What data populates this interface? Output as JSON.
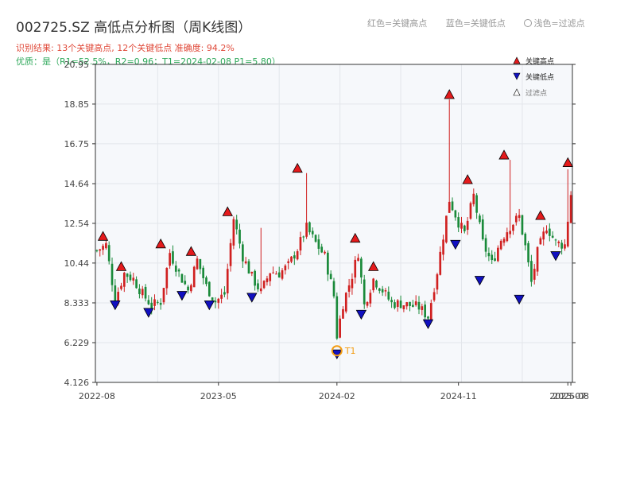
{
  "header": {
    "title": "002725.SZ 高低点分析图（周K线图）",
    "subtitle_result": "识别结果: 13个关键高点, 12个关键低点   准确度: 94.2%",
    "subtitle_quality": "优质：是（R1=52.5%，R2=0.96；T1=2024-02-08 P1=5.80）",
    "color_key": [
      {
        "text": "红色=关键高点"
      },
      {
        "text": "蓝色=关键低点"
      },
      {
        "text": "浅色=过滤点"
      }
    ]
  },
  "legend": {
    "entries": [
      {
        "label": "关键高点",
        "color": "#e41a1c"
      },
      {
        "label": "关键低点",
        "color": "#1010c0"
      },
      {
        "label": "过滤点",
        "color": "#ffffff"
      }
    ]
  },
  "chart_data": {
    "type": "candlestick",
    "yticks": [
      "4.126",
      "6.229",
      "8.333",
      "10.44",
      "12.54",
      "14.64",
      "16.75",
      "18.85",
      "20.95"
    ],
    "ylim": [
      4.126,
      20.95
    ],
    "xticks": [
      {
        "label": "2022-08",
        "week": 0
      },
      {
        "label": "2023-05",
        "week": 40
      },
      {
        "label": "2024-02",
        "week": 79
      },
      {
        "label": "2024-11",
        "week": 119
      },
      {
        "label": "2025-07",
        "week": 155
      },
      {
        "label": "2025-08",
        "week": 156
      }
    ],
    "weeks": 157,
    "up_color": "#d02020",
    "down_color": "#1a8a3a",
    "anchors": [
      [
        0,
        11.1
      ],
      [
        3,
        11.4
      ],
      [
        6,
        8.5
      ],
      [
        9,
        9.9
      ],
      [
        12,
        9.6
      ],
      [
        15,
        8.8
      ],
      [
        18,
        8.2
      ],
      [
        21,
        8.4
      ],
      [
        24,
        11.0
      ],
      [
        27,
        9.9
      ],
      [
        30,
        9.0
      ],
      [
        33,
        10.6
      ],
      [
        36,
        9.2
      ],
      [
        39,
        8.4
      ],
      [
        42,
        8.8
      ],
      [
        45,
        12.8
      ],
      [
        48,
        10.8
      ],
      [
        51,
        9.7
      ],
      [
        54,
        8.9
      ],
      [
        57,
        10.0
      ],
      [
        60,
        9.9
      ],
      [
        63,
        10.3
      ],
      [
        66,
        11.2
      ],
      [
        69,
        12.3
      ],
      [
        72,
        11.5
      ],
      [
        75,
        10.8
      ],
      [
        78,
        8.7
      ],
      [
        79,
        6.6
      ],
      [
        81,
        8.3
      ],
      [
        84,
        9.8
      ],
      [
        86,
        11.0
      ],
      [
        88,
        8.2
      ],
      [
        91,
        9.6
      ],
      [
        94,
        9.0
      ],
      [
        97,
        8.3
      ],
      [
        100,
        8.3
      ],
      [
        103,
        8.2
      ],
      [
        106,
        8.1
      ],
      [
        109,
        7.6
      ],
      [
        112,
        10.0
      ],
      [
        116,
        13.8
      ],
      [
        119,
        12.6
      ],
      [
        121,
        12.0
      ],
      [
        124,
        14.0
      ],
      [
        127,
        11.5
      ],
      [
        130,
        10.4
      ],
      [
        133,
        11.7
      ],
      [
        136,
        12.4
      ],
      [
        139,
        12.9
      ],
      [
        141,
        11.3
      ],
      [
        143,
        9.4
      ],
      [
        145,
        11.0
      ],
      [
        148,
        12.4
      ],
      [
        151,
        11.5
      ],
      [
        154,
        11.4
      ],
      [
        156,
        14.1
      ],
      [
        157,
        13.1
      ]
    ],
    "spikes": [
      {
        "w": 45,
        "h": 12.9
      },
      {
        "w": 54,
        "h": 12.3
      },
      {
        "w": 69,
        "h": 15.2
      },
      {
        "w": 116,
        "h": 19.1
      },
      {
        "w": 136,
        "h": 15.9
      },
      {
        "w": 155,
        "h": 15.4
      }
    ],
    "key_highs": [
      {
        "w": 2,
        "v": 11.6
      },
      {
        "w": 8,
        "v": 10.0
      },
      {
        "w": 21,
        "v": 11.2
      },
      {
        "w": 31,
        "v": 10.8
      },
      {
        "w": 43,
        "v": 12.9
      },
      {
        "w": 66,
        "v": 15.2
      },
      {
        "w": 85,
        "v": 11.5
      },
      {
        "w": 91,
        "v": 10.0
      },
      {
        "w": 116,
        "v": 19.1
      },
      {
        "w": 122,
        "v": 14.6
      },
      {
        "w": 134,
        "v": 15.9
      },
      {
        "w": 146,
        "v": 12.7
      },
      {
        "w": 155,
        "v": 15.5
      }
    ],
    "key_lows": [
      {
        "w": 6,
        "v": 8.4
      },
      {
        "w": 17,
        "v": 8.0
      },
      {
        "w": 28,
        "v": 8.9
      },
      {
        "w": 37,
        "v": 8.4
      },
      {
        "w": 51,
        "v": 8.8
      },
      {
        "w": 79,
        "v": 5.8
      },
      {
        "w": 87,
        "v": 7.9
      },
      {
        "w": 109,
        "v": 7.4
      },
      {
        "w": 118,
        "v": 11.6
      },
      {
        "w": 126,
        "v": 9.7
      },
      {
        "w": 139,
        "v": 8.7
      },
      {
        "w": 151,
        "v": 11.0
      }
    ],
    "t1_marker": {
      "w": 79,
      "v": 5.8,
      "label": "T1",
      "color": "#f39c12"
    }
  }
}
